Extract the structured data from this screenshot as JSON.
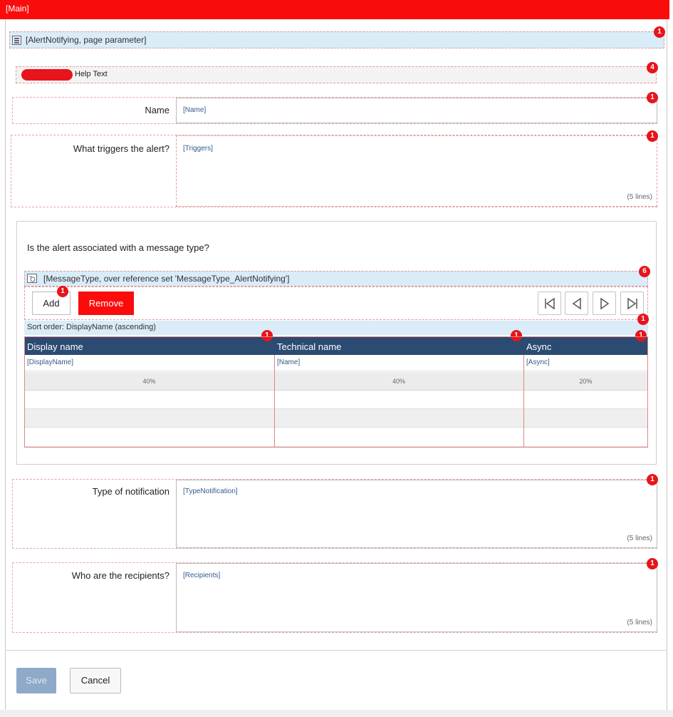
{
  "main_label": "[Main]",
  "dataview": {
    "title": "[AlertNotifying, page parameter]"
  },
  "help": {
    "text": "Help Text"
  },
  "fields": {
    "name": {
      "label": "Name",
      "value": "[Name]"
    },
    "triggers": {
      "label": "What triggers the alert?",
      "value": "[Triggers]",
      "lines": "(5 lines)"
    },
    "type_notification": {
      "label": "Type of notification",
      "value": "[TypeNotification]",
      "lines": "(5 lines)"
    },
    "recipients": {
      "label": "Who are the recipients?",
      "value": "[Recipients]",
      "lines": "(5 lines)"
    }
  },
  "message_group": {
    "question": "Is the alert associated with a message type?",
    "grid_title": "[MessageType, over reference set 'MessageType_AlertNotifying']",
    "add_label": "Add",
    "remove_label": "Remove",
    "sort_order": "Sort order: DisplayName (ascending)",
    "columns": [
      {
        "header": "Display name",
        "binding": "[DisplayName]",
        "width": "40%"
      },
      {
        "header": "Technical name",
        "binding": "[Name]",
        "width": "40%"
      },
      {
        "header": "Async",
        "binding": "[Async]",
        "width": "20%"
      }
    ]
  },
  "badges": {
    "dataview": "1",
    "help": "4",
    "name": "1",
    "triggers": "1",
    "grid": "6",
    "add": "1",
    "sort": "1",
    "col1": "1",
    "col2": "1",
    "col3": "1",
    "type_notification": "1",
    "recipients": "1"
  },
  "footer": {
    "save_label": "Save",
    "cancel_label": "Cancel"
  },
  "colors": {
    "accent_red": "#fb0c0c",
    "header_navy": "#2b4b72",
    "light_blue": "#d9ecf8",
    "save_disabled": "#8fa9c8"
  }
}
